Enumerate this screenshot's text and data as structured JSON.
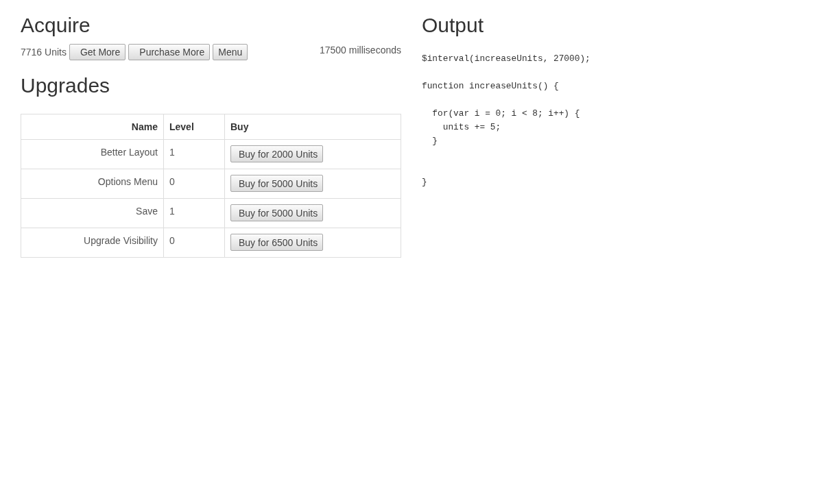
{
  "acquire": {
    "title": "Acquire",
    "units": "7716 Units",
    "buttons": [
      "Get More",
      "Purchase More",
      "Menu"
    ],
    "timer": "17500 milliseconds"
  },
  "upgrades": {
    "title": "Upgrades",
    "columns": [
      "Name",
      "Level",
      "Buy"
    ],
    "rows": [
      {
        "name": "Better Layout",
        "level_number": "1",
        "buy": "Buy for 2000 Units"
      },
      {
        "name": "Options Menu",
        "level_number": "0",
        "buy": "Buy for 5000 Units"
      },
      {
        "name": "Save",
        "level_number": "1",
        "buy": "Buy for 5000 Units"
      },
      {
        "name": "Upgrade Visibility",
        "level_number": "0",
        "buy": "Buy for 6500 Units"
      }
    ]
  },
  "output": {
    "title": "Output",
    "code": "$interval(increaseUnits, 27000);\n\nfunction increaseUnits() {\n\n  for(var i = 0; i < 8; i++) {\n    units += 5;\n  }\n\n\n}"
  }
}
